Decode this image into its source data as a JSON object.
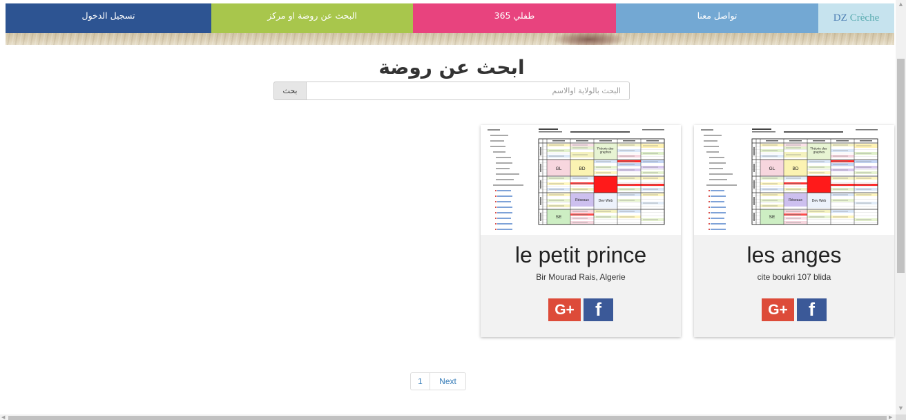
{
  "nav": {
    "items": [
      {
        "label": "تسجيل الدخول",
        "color": "#2d5492"
      },
      {
        "label": "البحث عن روضة او مركز",
        "color": "#a8c64c"
      },
      {
        "label": "طفلي 365",
        "color": "#e8437e"
      },
      {
        "label": "تواصل معنا",
        "color": "#73a8d3"
      }
    ]
  },
  "brand": {
    "part1": "DZ",
    "part2": "Crèche",
    "background": "#c6e3ee",
    "part1_color": "#4c7eb3",
    "part2_color": "#58abb0"
  },
  "main": {
    "title": "ابحث عن روضة"
  },
  "search": {
    "button_label": "بحث",
    "placeholder": "البحث بالولاية اوالاسم"
  },
  "cards": [
    {
      "name": "les anges",
      "address": "cite boukri 107 blida"
    },
    {
      "name": "le petit prince",
      "address": "Bir Mourad Rais, Algerie"
    }
  ],
  "card_image": {
    "labels": [
      "Théorie des graphes",
      "GL",
      "BD",
      "Réseaux",
      "Dev Web",
      "SE"
    ]
  },
  "social": [
    {
      "icon": "google-plus-icon",
      "glyph": "G+",
      "color": "#dd4b39"
    },
    {
      "icon": "facebook-icon",
      "glyph": "f",
      "color": "#3b5998"
    }
  ],
  "pagination": {
    "pages": [
      "1"
    ],
    "next_label": "Next",
    "link_color": "#337ab7"
  },
  "scrollbars": {
    "up_glyph": "▲",
    "down_glyph": "▼",
    "left_glyph": "◀",
    "right_glyph": "▶"
  }
}
